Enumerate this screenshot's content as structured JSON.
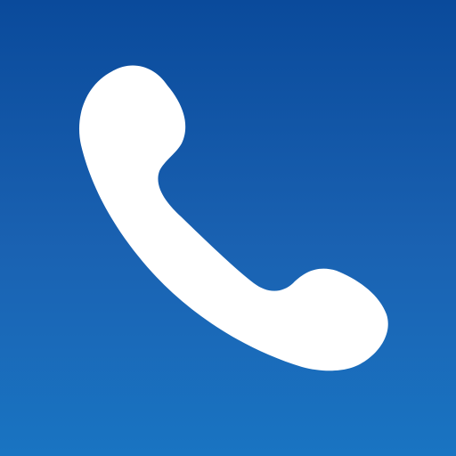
{
  "icon": {
    "name": "phone-icon",
    "colors": {
      "background_top": "#0A4A9B",
      "background_bottom": "#1974C2",
      "glyph": "#FFFFFF"
    }
  }
}
